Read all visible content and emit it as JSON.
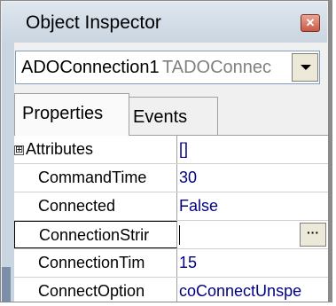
{
  "window": {
    "title": "Object Inspector",
    "close_icon": "close-icon"
  },
  "component_selector": {
    "name": "ADOConnection1",
    "type": "TADOConnec",
    "dropdown_icon": "chevron-down-icon"
  },
  "tabs": [
    {
      "label": "Properties",
      "active": true
    },
    {
      "label": "Events",
      "active": false
    }
  ],
  "properties": [
    {
      "name": "Attributes",
      "value": "[]",
      "expandable": true,
      "expander": "⊞"
    },
    {
      "name": "CommandTimeout",
      "display_name": "CommandTime",
      "value": "30"
    },
    {
      "name": "Connected",
      "value": "False"
    },
    {
      "name": "ConnectionString",
      "display_name": "ConnectionStrir",
      "value": "",
      "selected": true,
      "ellipsis": "···"
    },
    {
      "name": "ConnectionTimeout",
      "display_name": "ConnectionTim",
      "value": "15"
    },
    {
      "name": "ConnectOptions",
      "display_name": "ConnectOption",
      "value": "coConnectUnspe"
    }
  ],
  "colors": {
    "title_bar": "#c9d5e1",
    "value_text": "#000080",
    "close_button": "#c85a45"
  }
}
